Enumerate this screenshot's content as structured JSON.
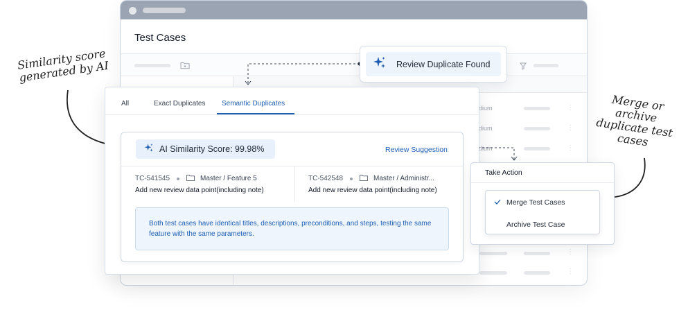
{
  "background_window": {
    "title": "Test Cases",
    "rows": [
      {
        "priority": "edium"
      },
      {
        "priority": "edium"
      },
      {
        "priority": "edium"
      }
    ]
  },
  "review_popup": {
    "label": "Review Duplicate Found",
    "icon": "sparkle-icon"
  },
  "modal": {
    "tabs": [
      {
        "label": "All",
        "active": false
      },
      {
        "label": "Exact Duplicates",
        "active": false
      },
      {
        "label": "Semantic Duplicates",
        "active": true
      }
    ],
    "score_label": "AI Similarity Score: 99.98%",
    "review_suggestion": "Review Suggestion",
    "left_case": {
      "id": "TC-541545",
      "path": "Master / Feature 5",
      "description": "Add new review data point(including note)"
    },
    "right_case": {
      "id": "TC-542548",
      "path": "Master / Administr...",
      "description": "Add new review data point(including note)"
    },
    "explanation": "Both test cases have identical titles, descriptions, preconditions, and steps, testing the same feature with the same parameters."
  },
  "take_action": {
    "title": "Take Action",
    "options": [
      {
        "label": "Merge Test Cases",
        "selected": true
      },
      {
        "label": "Archive Test Case",
        "selected": false
      }
    ]
  },
  "annotations": {
    "left_line1": "Similarity score",
    "left_line2": "generated by AI",
    "right_line1": "Merge or",
    "right_line2": "archive",
    "right_line3": "duplicate test",
    "right_line4": "cases"
  },
  "colors": {
    "accent": "#1e5fb3",
    "titlebar": "#9aa4b2",
    "note_bg": "#eef5fc"
  }
}
